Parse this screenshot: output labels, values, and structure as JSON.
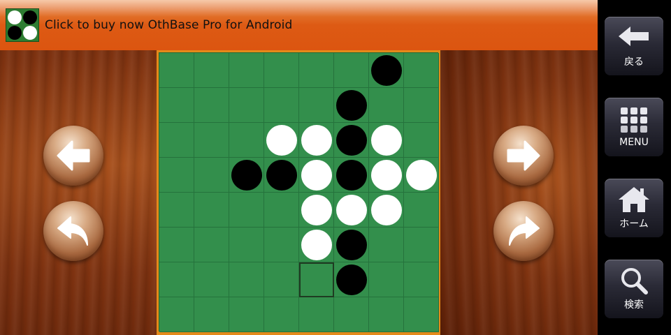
{
  "banner": {
    "text": "Click to buy now OthBase Pro for Android",
    "logo_icon": "othello-discs-logo"
  },
  "board": {
    "size": 8,
    "colors": {
      "square": "#338f4c",
      "frame": "#e48a1a",
      "black": "#000000",
      "white": "#ffffff"
    },
    "rows": [
      "......B.",
      ".....B..",
      "...WWBW.",
      "..BBWBWW",
      "....WWW.",
      "....WB..",
      ".....B..",
      "........"
    ],
    "last_move": {
      "row": 6,
      "col": 4
    }
  },
  "controls": {
    "back_move": "arrow-left-icon",
    "undo": "undo-curved-arrow-icon",
    "forward_move": "arrow-right-icon",
    "redo": "redo-curved-arrow-icon"
  },
  "sidebar": {
    "back_label": "戻る",
    "menu_label": "MENU",
    "home_label": "ホーム",
    "search_label": "検索"
  }
}
